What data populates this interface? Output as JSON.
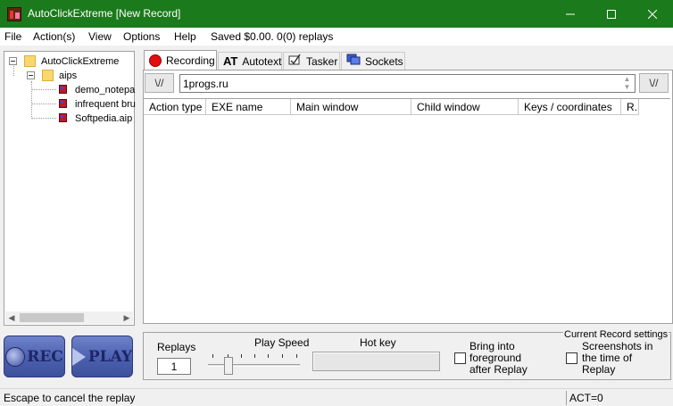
{
  "window": {
    "title": "AutoClickExtreme [New Record]",
    "colors": {
      "titlebar": "#1b7a1b",
      "recording_dot": "#e01010"
    }
  },
  "menu": {
    "items": [
      "File",
      "Action(s)",
      "View",
      "Options",
      "Help"
    ],
    "status": "Saved $0.00. 0(0) replays"
  },
  "tree": {
    "root": "AutoClickExtreme",
    "folder": "aips",
    "files": [
      "demo_notepa",
      "infrequent bru",
      "Softpedia.aip"
    ]
  },
  "buttons": {
    "rec": "REC",
    "play": "PLAY",
    "up_glyph": "\\//",
    "down_glyph": "\\//"
  },
  "tabs": [
    {
      "label": "Recording",
      "icon": "record-dot-icon"
    },
    {
      "label": "Autotext",
      "icon": "at-icon",
      "icon_text": "AT"
    },
    {
      "label": "Tasker",
      "icon": "tasker-icon"
    },
    {
      "label": "Sockets",
      "icon": "monitor-icon"
    }
  ],
  "recording": {
    "input_value": "1progs.ru",
    "columns": [
      "Action type",
      "EXE name",
      "Main window",
      "Child window",
      "Keys / coordinates",
      "R..."
    ]
  },
  "settings": {
    "replays_label": "Replays",
    "replays_value": "1",
    "play_speed_label": "Play Speed",
    "play_speed_value": 0.2,
    "hot_key_label": "Hot key",
    "bring_foreground_label": "Bring into foreground after Replay",
    "bring_foreground_checked": false,
    "group_title": "Current Record settings",
    "screenshots_label": "Screenshots in the time of Replay",
    "screenshots_checked": false
  },
  "status": {
    "message": "Escape to cancel the replay",
    "act": "ACT=0"
  }
}
